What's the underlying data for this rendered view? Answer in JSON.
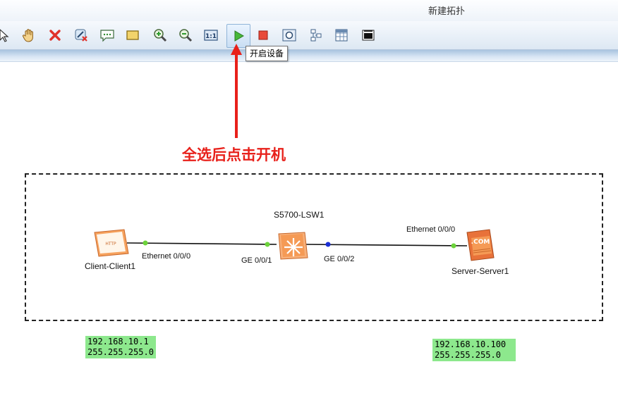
{
  "window": {
    "title": "新建拓扑"
  },
  "toolbar": {
    "buttons": [
      {
        "name": "select-tool",
        "icon": "cursor-icon"
      },
      {
        "name": "pan-tool",
        "icon": "hand-icon"
      },
      {
        "name": "delete",
        "icon": "red-x-icon"
      },
      {
        "name": "delete-link",
        "icon": "unlink-icon"
      },
      {
        "name": "text-note",
        "icon": "speech-bubble-icon"
      },
      {
        "name": "shape",
        "icon": "rectangle-icon"
      },
      {
        "name": "zoom-in",
        "icon": "zoom-in-icon"
      },
      {
        "name": "zoom-out",
        "icon": "zoom-out-icon"
      },
      {
        "name": "zoom-reset",
        "icon": "one-to-one-icon"
      },
      {
        "name": "start-device",
        "icon": "play-icon"
      },
      {
        "name": "stop-device",
        "icon": "stop-icon"
      },
      {
        "name": "capture",
        "icon": "capture-icon"
      },
      {
        "name": "topology",
        "icon": "topology-icon"
      },
      {
        "name": "grid",
        "icon": "grid-icon"
      },
      {
        "name": "cli",
        "icon": "terminal-icon"
      }
    ],
    "tooltip": "开启设备"
  },
  "annotation": "全选后点击开机",
  "topology": {
    "devices": [
      {
        "id": "client",
        "name": "Client-Client1",
        "icon_text": "HTTP"
      },
      {
        "id": "switch",
        "name": "S5700-LSW1"
      },
      {
        "id": "server",
        "name": "Server-Server1",
        "icon_text": ".COM"
      }
    ],
    "links": [
      {
        "from": "Client-Client1",
        "from_port": "Ethernet 0/0/0",
        "to": "S5700-LSW1",
        "to_port": "GE 0/0/1"
      },
      {
        "from": "S5700-LSW1",
        "from_port": "GE 0/0/2",
        "to": "Server-Server1",
        "to_port": "Ethernet 0/0/0"
      }
    ],
    "port_status_colors": {
      "up": "#6cd33b",
      "blue": "#1a2fd6"
    }
  },
  "notes": {
    "client": {
      "ip": "192.168.10.1",
      "mask": "255.255.255.0"
    },
    "server": {
      "ip": "192.168.10.100",
      "mask": "255.255.255.0"
    }
  },
  "colors": {
    "annotation": "#e8201a",
    "note_bg": "#8de88d",
    "accent": "#d8e6f4"
  }
}
